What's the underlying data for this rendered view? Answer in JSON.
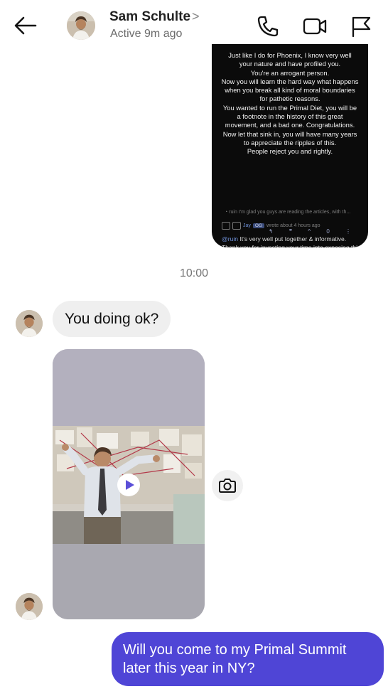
{
  "header": {
    "contact_name": "Sam Schulte",
    "chevron": ">",
    "status": "Active 9m ago"
  },
  "screenshot_message": {
    "lines": [
      "Just like I do for Phoenix, I know very well",
      "your nature and have profiled you.",
      "You're an arrogant person.",
      "Now you will learn the hard way what happens",
      "when you break all kind of moral boundaries",
      "for pathetic reasons.",
      "You wanted to run the Primal Diet, you will be",
      "a footnote in the history of this great",
      "movement, and a bad one. Congratulations.",
      "Now let that sink in, you will have many years",
      "to appreciate the ripples of this.",
      "People reject you and rightly."
    ],
    "meta_reply": "I'm glad you guys are reading the articles, with th...",
    "meta_reply_user": "ruin",
    "author": "Jay",
    "author_badge": "OG",
    "time": "wrote about 4 hours ago",
    "mention": "@ruin",
    "comment": "It's very well put together & informative. Thank you for investing your time into exposing this nonsense.",
    "actions": "↰ ❞ ^ 0 ⋮"
  },
  "timestamp": "10:00",
  "incoming_text": "You doing ok?",
  "outgoing": {
    "line1": "Will you come to my Primal Summit",
    "line2": "later this year in NY?"
  },
  "colors": {
    "outgoing_bubble": "#4f45d6",
    "incoming_bubble": "#efefef",
    "video_bg": "#aeaab9"
  }
}
